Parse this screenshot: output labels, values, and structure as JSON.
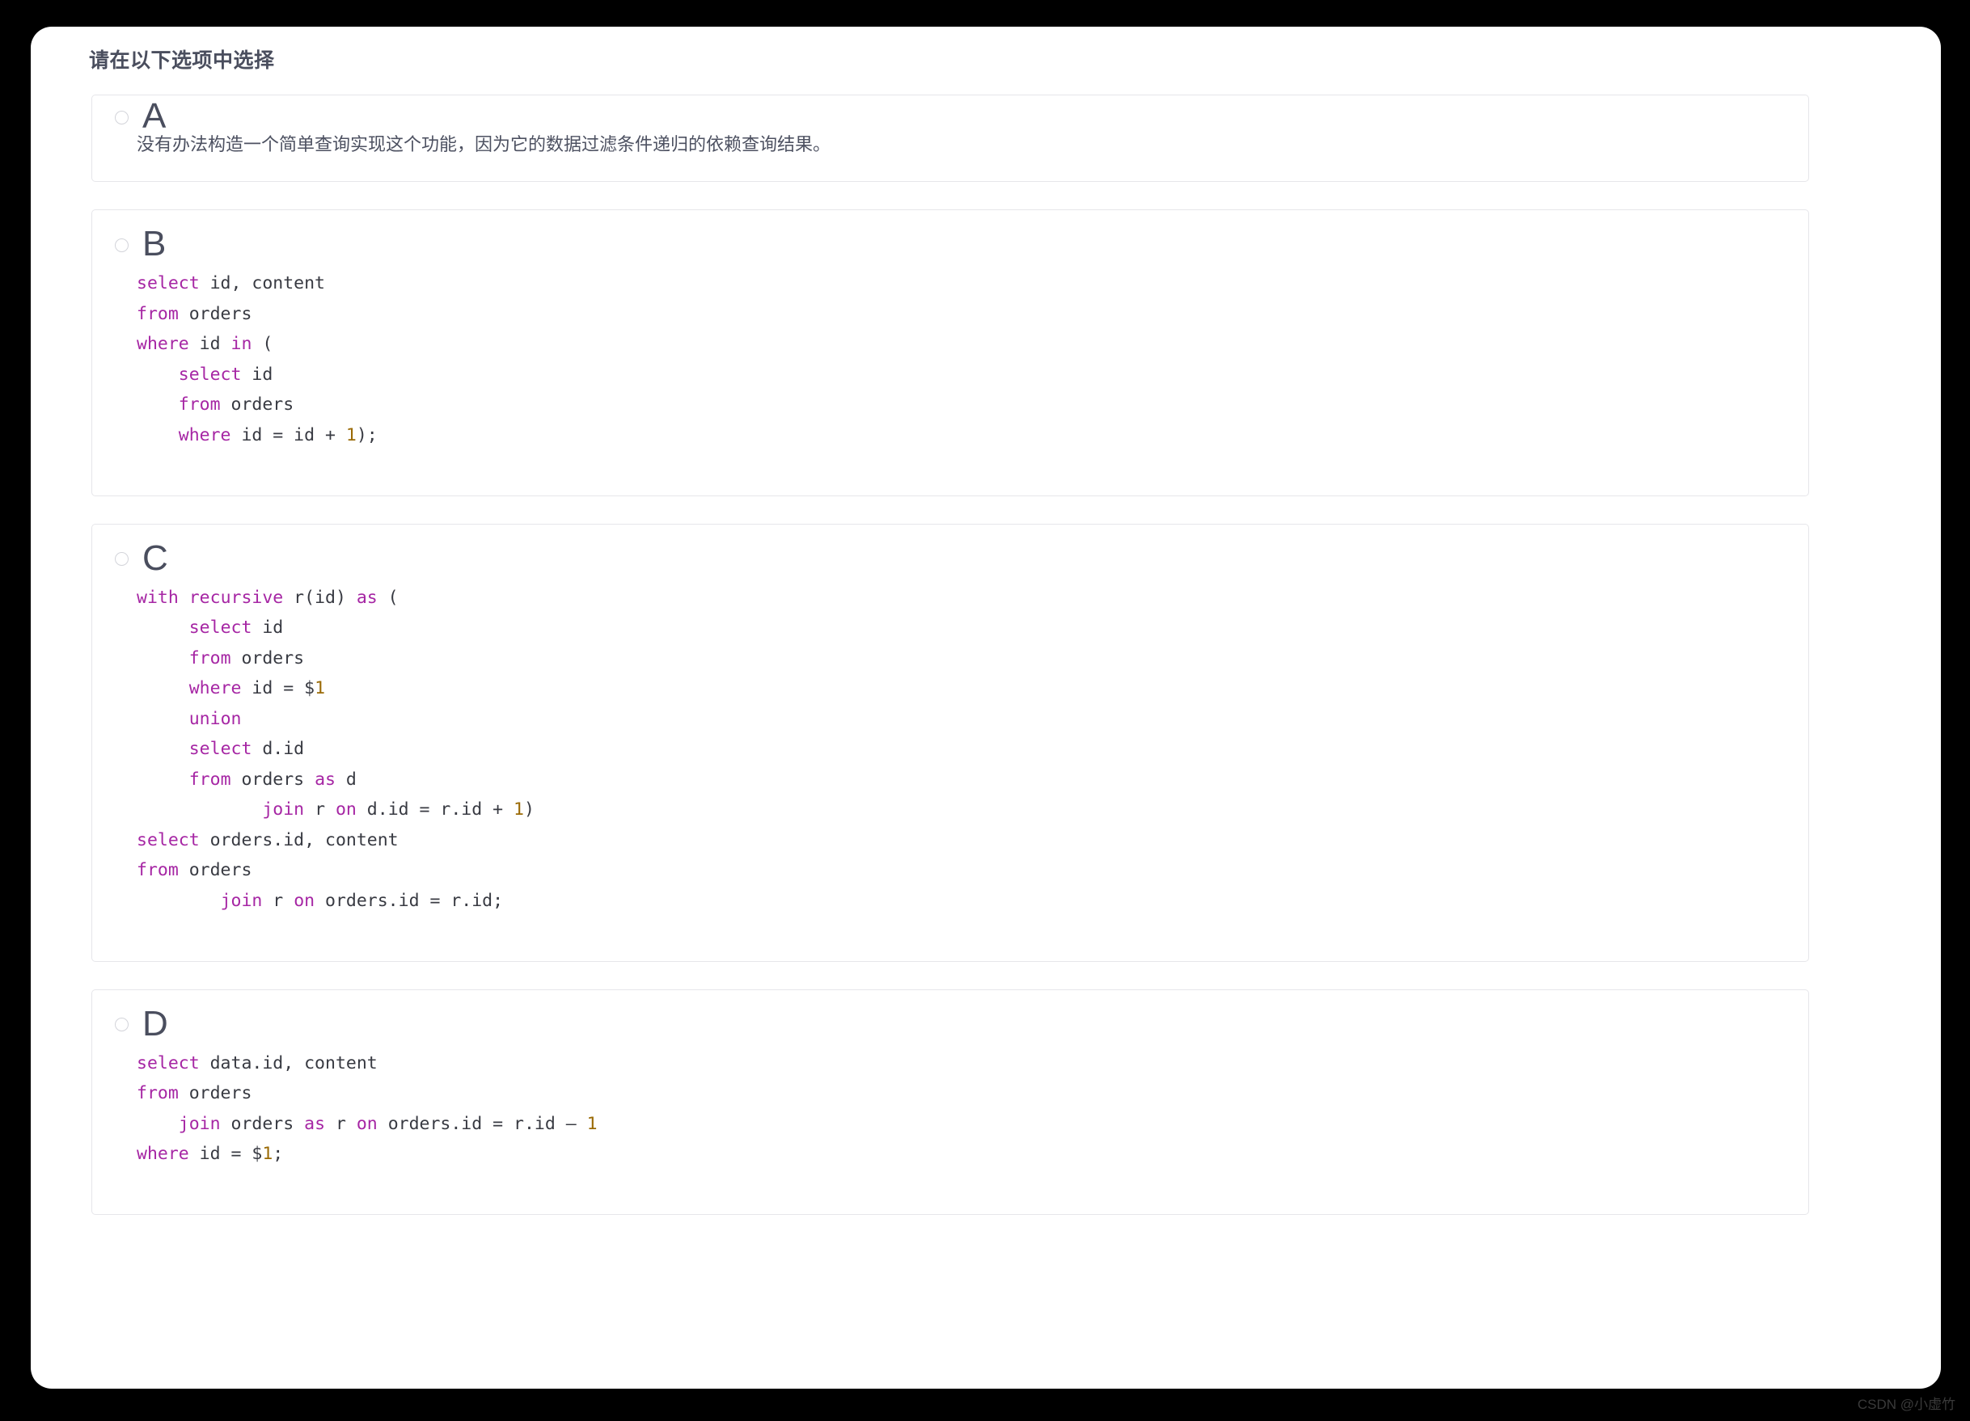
{
  "page": {
    "title": "请在以下选项中选择",
    "watermark": "CSDN @小虚竹"
  },
  "colors": {
    "background": "#000000",
    "sheet": "#ffffff",
    "card_border": "#e6e6ea",
    "title_text": "#4a4e5e",
    "letter_text": "#4a4e5e",
    "code_default": "#383a42",
    "code_keyword": "#a626a4",
    "code_number": "#9a6a05",
    "radio_border": "#d3d4da",
    "watermark_text": "#3a3a3a"
  },
  "options": [
    {
      "id": "a",
      "letter": "A",
      "selected": false,
      "kind": "text",
      "text": "没有办法构造一个简单查询实现这个功能，因为它的数据过滤条件递归的依赖查询结果。"
    },
    {
      "id": "b",
      "letter": "B",
      "selected": false,
      "kind": "code",
      "language": "sql",
      "code_plain": "select id, content\nfrom orders\nwhere id in (\n    select id\n    from orders\n    where id = id + 1);",
      "code_tokens": [
        [
          {
            "t": "select",
            "c": "kw"
          },
          {
            "t": " id, content",
            "c": "op"
          }
        ],
        [
          {
            "t": "from",
            "c": "kw"
          },
          {
            "t": " orders",
            "c": "op"
          }
        ],
        [
          {
            "t": "where",
            "c": "kw"
          },
          {
            "t": " id ",
            "c": "op"
          },
          {
            "t": "in",
            "c": "kw"
          },
          {
            "t": " (",
            "c": "op"
          }
        ],
        [
          {
            "t": "    ",
            "c": "op"
          },
          {
            "t": "select",
            "c": "kw"
          },
          {
            "t": " id",
            "c": "op"
          }
        ],
        [
          {
            "t": "    ",
            "c": "op"
          },
          {
            "t": "from",
            "c": "kw"
          },
          {
            "t": " orders",
            "c": "op"
          }
        ],
        [
          {
            "t": "    ",
            "c": "op"
          },
          {
            "t": "where",
            "c": "kw"
          },
          {
            "t": " id = id + ",
            "c": "op"
          },
          {
            "t": "1",
            "c": "num"
          },
          {
            "t": ");",
            "c": "op"
          }
        ]
      ]
    },
    {
      "id": "c",
      "letter": "C",
      "selected": false,
      "kind": "code",
      "language": "sql",
      "code_plain": "with recursive r(id) as (\n     select id\n     from orders\n     where id = $1\n     union\n     select d.id\n     from orders as d\n            join r on d.id = r.id + 1)\nselect orders.id, content\nfrom orders\n        join r on orders.id = r.id;",
      "code_tokens": [
        [
          {
            "t": "with",
            "c": "kw"
          },
          {
            "t": " ",
            "c": "op"
          },
          {
            "t": "recursive",
            "c": "kw"
          },
          {
            "t": " r(id) ",
            "c": "op"
          },
          {
            "t": "as",
            "c": "kw"
          },
          {
            "t": " (",
            "c": "op"
          }
        ],
        [
          {
            "t": "     ",
            "c": "op"
          },
          {
            "t": "select",
            "c": "kw"
          },
          {
            "t": " id",
            "c": "op"
          }
        ],
        [
          {
            "t": "     ",
            "c": "op"
          },
          {
            "t": "from",
            "c": "kw"
          },
          {
            "t": " orders",
            "c": "op"
          }
        ],
        [
          {
            "t": "     ",
            "c": "op"
          },
          {
            "t": "where",
            "c": "kw"
          },
          {
            "t": " id = $",
            "c": "op"
          },
          {
            "t": "1",
            "c": "num"
          }
        ],
        [
          {
            "t": "     ",
            "c": "op"
          },
          {
            "t": "union",
            "c": "kw"
          }
        ],
        [
          {
            "t": "     ",
            "c": "op"
          },
          {
            "t": "select",
            "c": "kw"
          },
          {
            "t": " d.id",
            "c": "op"
          }
        ],
        [
          {
            "t": "     ",
            "c": "op"
          },
          {
            "t": "from",
            "c": "kw"
          },
          {
            "t": " orders ",
            "c": "op"
          },
          {
            "t": "as",
            "c": "kw"
          },
          {
            "t": " d",
            "c": "op"
          }
        ],
        [
          {
            "t": "            ",
            "c": "op"
          },
          {
            "t": "join",
            "c": "kw"
          },
          {
            "t": " r ",
            "c": "op"
          },
          {
            "t": "on",
            "c": "kw"
          },
          {
            "t": " d.id = r.id + ",
            "c": "op"
          },
          {
            "t": "1",
            "c": "num"
          },
          {
            "t": ")",
            "c": "op"
          }
        ],
        [
          {
            "t": "select",
            "c": "kw"
          },
          {
            "t": " orders.id, content",
            "c": "op"
          }
        ],
        [
          {
            "t": "from",
            "c": "kw"
          },
          {
            "t": " orders",
            "c": "op"
          }
        ],
        [
          {
            "t": "        ",
            "c": "op"
          },
          {
            "t": "join",
            "c": "kw"
          },
          {
            "t": " r ",
            "c": "op"
          },
          {
            "t": "on",
            "c": "kw"
          },
          {
            "t": " orders.id = r.id;",
            "c": "op"
          }
        ]
      ]
    },
    {
      "id": "d",
      "letter": "D",
      "selected": false,
      "kind": "code",
      "language": "sql",
      "code_plain": "select data.id, content\nfrom orders\n    join orders as r on orders.id = r.id – 1\nwhere id = $1;",
      "code_tokens": [
        [
          {
            "t": "select",
            "c": "kw"
          },
          {
            "t": " data.id, content",
            "c": "op"
          }
        ],
        [
          {
            "t": "from",
            "c": "kw"
          },
          {
            "t": " orders",
            "c": "op"
          }
        ],
        [
          {
            "t": "    ",
            "c": "op"
          },
          {
            "t": "join",
            "c": "kw"
          },
          {
            "t": " orders ",
            "c": "op"
          },
          {
            "t": "as",
            "c": "kw"
          },
          {
            "t": " r ",
            "c": "op"
          },
          {
            "t": "on",
            "c": "kw"
          },
          {
            "t": " orders.id = r.id – ",
            "c": "op"
          },
          {
            "t": "1",
            "c": "num"
          }
        ],
        [
          {
            "t": "where",
            "c": "kw"
          },
          {
            "t": " id = $",
            "c": "op"
          },
          {
            "t": "1",
            "c": "num"
          },
          {
            "t": ";",
            "c": "op"
          }
        ]
      ]
    }
  ]
}
